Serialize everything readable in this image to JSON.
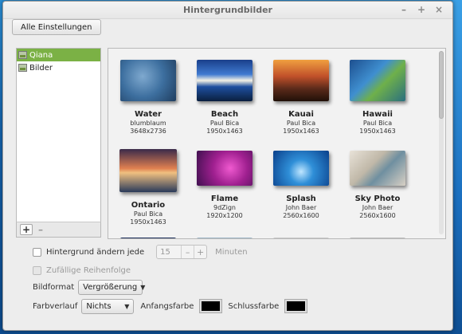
{
  "window": {
    "title": "Hintergrundbilder",
    "controls": {
      "minimize": "–",
      "maximize": "+",
      "close": "×"
    }
  },
  "toolbar": {
    "all_settings_label": "Alle Einstellungen"
  },
  "sources": {
    "items": [
      {
        "label": "Qiana",
        "selected": true
      },
      {
        "label": "Bilder",
        "selected": false
      }
    ],
    "add_label": "+",
    "remove_label": "–"
  },
  "wallpapers": [
    {
      "name": "Water",
      "author": "blumblaum",
      "size": "3648x2736"
    },
    {
      "name": "Beach",
      "author": "Paul Bica",
      "size": "1950x1463"
    },
    {
      "name": "Kauai",
      "author": "Paul Bica",
      "size": "1950x1463"
    },
    {
      "name": "Hawaii",
      "author": "Paul Bica",
      "size": "1950x1463"
    },
    {
      "name": "Ontario",
      "author": "Paul Bica",
      "size": "1950x1463"
    },
    {
      "name": "Flame",
      "author": "9dZign",
      "size": "1920x1200"
    },
    {
      "name": "Splash",
      "author": "John Baer",
      "size": "2560x1600"
    },
    {
      "name": "Sky Photo",
      "author": "John Baer",
      "size": "2560x1600"
    }
  ],
  "controls": {
    "change_label": "Hintergrund ändern jede",
    "interval_value": "15",
    "interval_unit": "Minuten",
    "spin_minus": "–",
    "spin_plus": "+",
    "random_label": "Zufällige Reihenfolge",
    "format_label": "Bildformat",
    "format_value": "Vergrößerung",
    "gradient_label": "Farbverlauf",
    "gradient_value": "Nichts",
    "start_color_label": "Anfangsfarbe",
    "end_color_label": "Schlussfarbe",
    "start_color": "#000000",
    "end_color": "#000000"
  }
}
